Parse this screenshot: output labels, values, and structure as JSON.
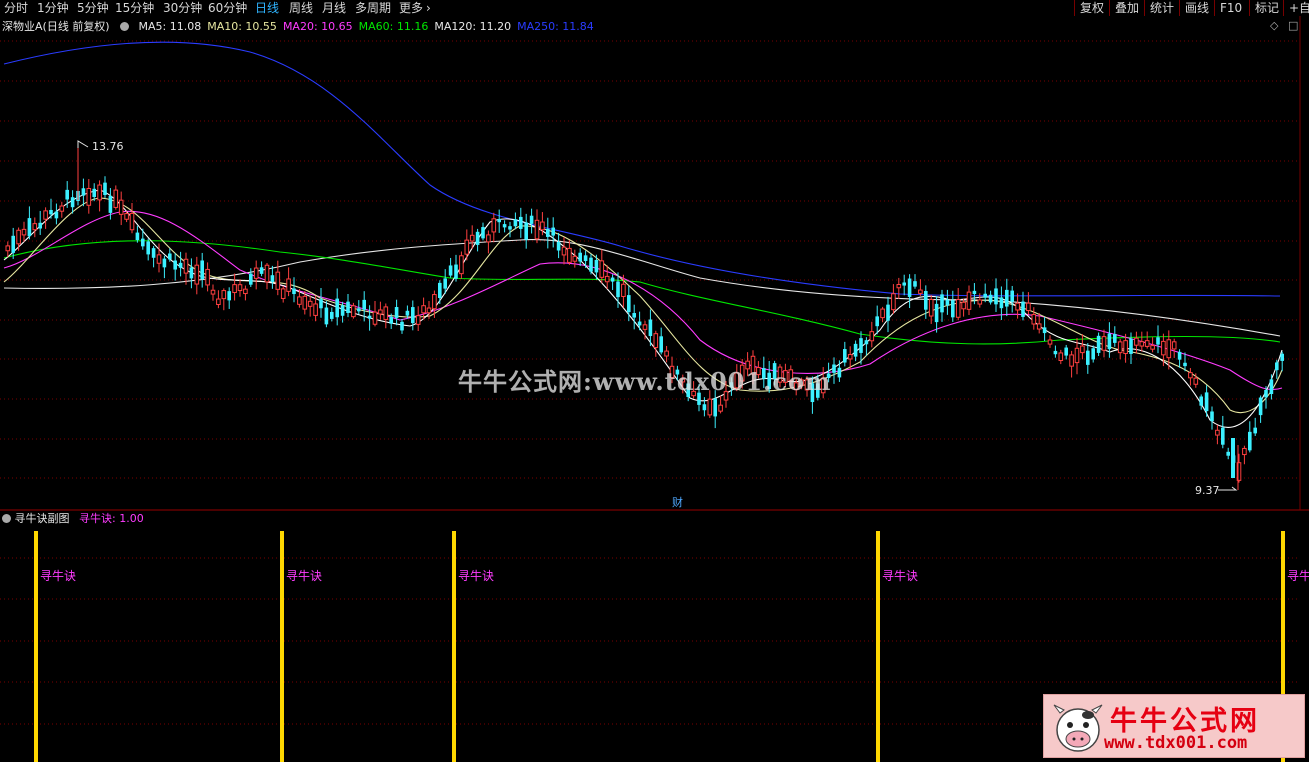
{
  "toolbar": {
    "periods": [
      "分时",
      "1分钟",
      "5分钟",
      "15分钟",
      "30分钟",
      "60分钟",
      "日线",
      "周线",
      "月线",
      "多周期",
      "更多"
    ],
    "active_period": "日线",
    "buttons": [
      "复权",
      "叠加",
      "统计",
      "画线",
      "F10",
      "标记",
      "+自选"
    ]
  },
  "main_chart": {
    "title": "深物业A(日线 前复权)",
    "ma": [
      {
        "label": "MA5: 11.08",
        "color": "#e6e6e6"
      },
      {
        "label": "MA10: 10.55",
        "color": "#e6e6a0"
      },
      {
        "label": "MA20: 10.65",
        "color": "#ff3cff"
      },
      {
        "label": "MA60: 11.16",
        "color": "#00e600"
      },
      {
        "label": "MA120: 11.20",
        "color": "#e6e6e6"
      },
      {
        "label": "MA250: 11.84",
        "color": "#2a3cff"
      }
    ],
    "high_label": "13.76",
    "low_label": "9.37",
    "event_label": "财",
    "colors": {
      "up": "#ff4040",
      "down": "#3cf0ff",
      "grid": "#7a0000"
    }
  },
  "sub_chart": {
    "title": "寻牛诀副图",
    "indicator": "寻牛诀: 1.00",
    "signal_label": "寻牛诀",
    "signal_color": "#ffd700"
  },
  "watermark": "牛牛公式网:www.tdx001.com",
  "logo": {
    "title": "牛牛公式网",
    "url": "www.tdx001.com"
  },
  "chart_data": {
    "type": "candlestick",
    "series": [
      {
        "name": "MA5",
        "value": 11.08
      },
      {
        "name": "MA10",
        "value": 10.55
      },
      {
        "name": "MA20",
        "value": 10.65
      },
      {
        "name": "MA60",
        "value": 11.16
      },
      {
        "name": "MA120",
        "value": 11.2
      },
      {
        "name": "MA250",
        "value": 11.84
      }
    ],
    "high": 13.76,
    "low": 9.37,
    "indicator_value": 1.0
  }
}
